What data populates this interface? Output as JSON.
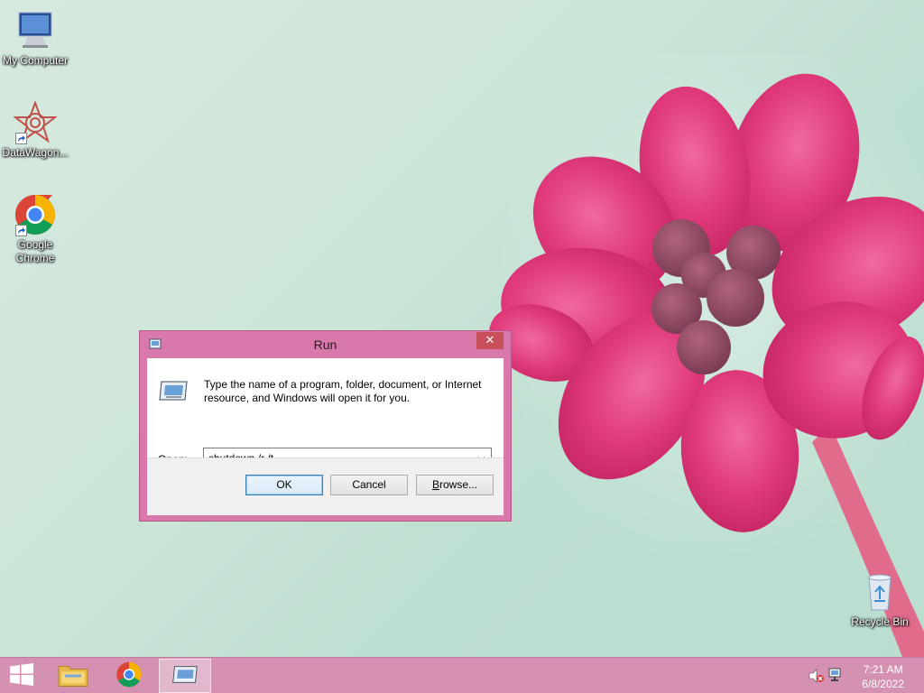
{
  "desktop": {
    "icons": [
      {
        "label": "My Computer",
        "icon": "computer-icon"
      },
      {
        "label": "DataWagon...",
        "icon": "datawagon-icon"
      },
      {
        "label": "Google Chrome",
        "icon": "chrome-icon"
      },
      {
        "label": "Recycle Bin",
        "icon": "recycle-bin-icon"
      }
    ]
  },
  "run_dialog": {
    "title": "Run",
    "close_label": "✕",
    "description": "Type the name of a program, folder, document, or Internet resource, and Windows will open it for you.",
    "open_label_accel": "O",
    "open_label_rest": "pen:",
    "open_value": "shutdown /r /t",
    "ok_label": "OK",
    "cancel_label": "Cancel",
    "browse_label_accel": "B",
    "browse_label_rest": "rowse..."
  },
  "taskbar": {
    "items": [
      "start-icon",
      "file-explorer-icon",
      "chrome-icon",
      "run-icon"
    ],
    "clock_time": "7:21 AM",
    "clock_date": "6/8/2022"
  },
  "colors": {
    "dialog_frame": "#d978aa",
    "taskbar": "#d491b2",
    "close_button": "#c7505a",
    "flower": "#e0407e"
  }
}
